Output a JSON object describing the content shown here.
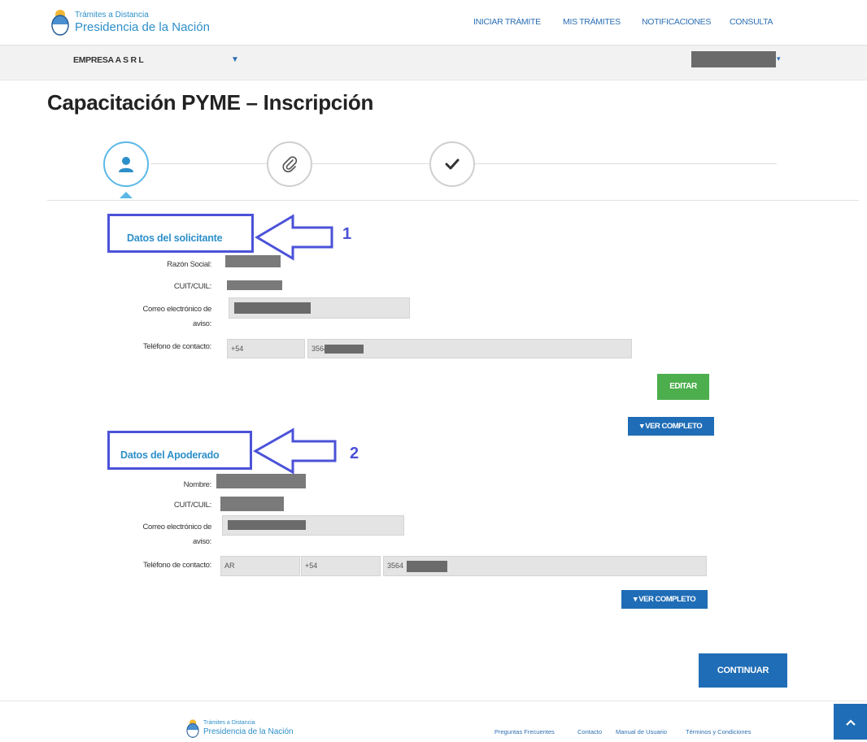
{
  "header": {
    "logo_line1": "Trámites a Distancia",
    "logo_line2": "Presidencia de la Nación",
    "nav": [
      "INICIAR TRÁMITE",
      "MIS TRÁMITES",
      "NOTIFICACIONES",
      "CONSULTA"
    ]
  },
  "company_bar": {
    "name": "EMPRESA A S R L",
    "caret": "▼",
    "user_caret": "▾"
  },
  "page_title": "Capacitación PYME – Inscripción",
  "stepper": {
    "active_step": 1,
    "steps": [
      "user-icon",
      "paperclip-icon",
      "check-icon"
    ]
  },
  "solicitante": {
    "title": "Datos del solicitante",
    "callout_number": "1",
    "labels": {
      "razon_social": "Razón Social:",
      "cuit": "CUIT/CUIL:",
      "correo_1": "Correo electrónico de",
      "correo_2": "aviso:",
      "telefono": "Teléfono de contacto:"
    },
    "telefono_prefix": "+54",
    "telefono_number": "3564",
    "edit_button": "EDITAR",
    "ver_completo": "▾ VER COMPLETO"
  },
  "apoderado": {
    "title": "Datos del Apoderado",
    "callout_number": "2",
    "labels": {
      "nombre": "Nombre:",
      "cuit": "CUIT/CUIL:",
      "correo_1": "Correo electrónico de",
      "correo_2": "aviso:",
      "telefono": "Teléfono de contacto:"
    },
    "telefono_country": "AR",
    "telefono_prefix": "+54",
    "telefono_number": "3564",
    "ver_completo": "▾ VER COMPLETO"
  },
  "continuar_button": "CONTINUAR",
  "footer": {
    "logo_line1": "Trámites a Distancia",
    "logo_line2": "Presidencia de la Nación",
    "links": [
      "Preguntas Frecuentes",
      "Contacto",
      "Manual de Usuario",
      "Términos y Condiciones"
    ]
  },
  "colors": {
    "brand": "#2d8fc9",
    "primary_button": "#1f6db6",
    "edit_button": "#4cae4c",
    "callout": "#4b52d8"
  }
}
